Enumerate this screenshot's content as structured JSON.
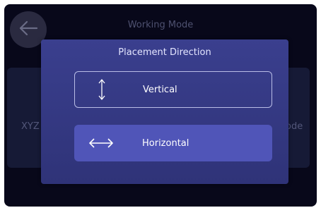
{
  "app": {
    "page_title": "Working Mode",
    "left_card_label": "XYZ",
    "right_card_label": "ode"
  },
  "dialog": {
    "title": "Placement Direction",
    "options": [
      {
        "label": "Vertical",
        "icon": "vertical-arrows-icon",
        "selected": false
      },
      {
        "label": "Horizontal",
        "icon": "horizontal-arrows-icon",
        "selected": true
      }
    ]
  },
  "colors": {
    "background": "#08081a",
    "dialog": "#363b86",
    "selected_option": "#5055b8",
    "option_border": "#b9bde6"
  }
}
